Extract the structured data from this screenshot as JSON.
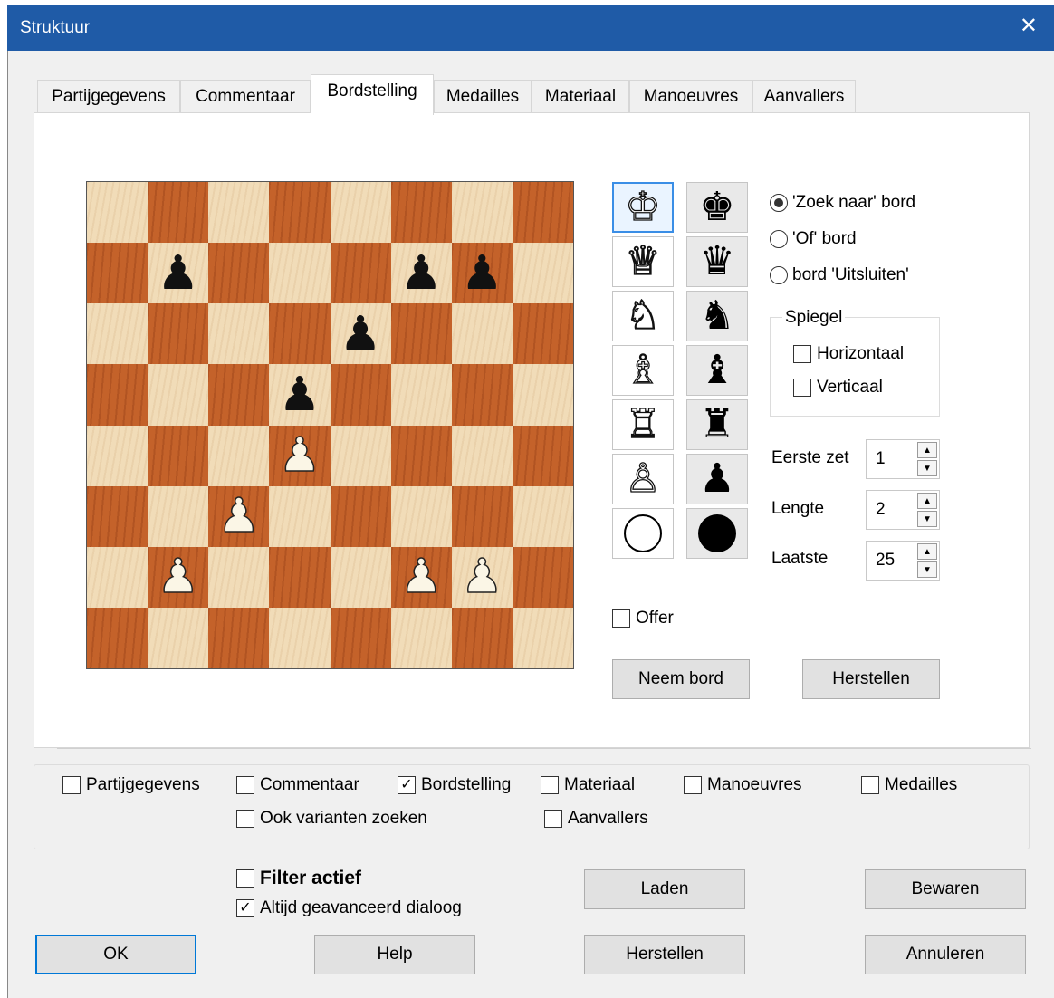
{
  "window": {
    "title": "Struktuur",
    "close_glyph": "✕"
  },
  "tabs": [
    {
      "label": "Partijgegevens",
      "active": false
    },
    {
      "label": "Commentaar",
      "active": false
    },
    {
      "label": "Bordstelling",
      "active": true
    },
    {
      "label": "Medailles",
      "active": false
    },
    {
      "label": "Materiaal",
      "active": false
    },
    {
      "label": "Manoeuvres",
      "active": false
    },
    {
      "label": "Aanvallers",
      "active": false
    }
  ],
  "board": {
    "position": [
      "........",
      ".p...pp.",
      "....p...",
      "...p....",
      "...P....",
      "..P.....",
      ".P...PP.",
      "........"
    ],
    "colors": {
      "light": "#f1dcb8",
      "dark": "#c4622a"
    }
  },
  "palette": {
    "selected": "white-king",
    "items": [
      {
        "name": "white-king-icon",
        "glyph": "♔",
        "color": "w"
      },
      {
        "name": "black-king-icon",
        "glyph": "♚",
        "color": "b"
      },
      {
        "name": "white-queen-icon",
        "glyph": "♕",
        "color": "w"
      },
      {
        "name": "black-queen-icon",
        "glyph": "♛",
        "color": "b"
      },
      {
        "name": "white-knight-icon",
        "glyph": "♘",
        "color": "w"
      },
      {
        "name": "black-knight-icon",
        "glyph": "♞",
        "color": "b"
      },
      {
        "name": "white-bishop-icon",
        "glyph": "♗",
        "color": "w"
      },
      {
        "name": "black-bishop-icon",
        "glyph": "♝",
        "color": "b"
      },
      {
        "name": "white-rook-icon",
        "glyph": "♖",
        "color": "w"
      },
      {
        "name": "black-rook-icon",
        "glyph": "♜",
        "color": "b"
      },
      {
        "name": "white-pawn-icon",
        "glyph": "♙",
        "color": "w"
      },
      {
        "name": "black-pawn-icon",
        "glyph": "♟",
        "color": "b"
      },
      {
        "name": "white-circle-icon",
        "glyph": "",
        "color": "w"
      },
      {
        "name": "black-circle-icon",
        "glyph": "",
        "color": "b"
      }
    ]
  },
  "search_mode": {
    "options": [
      {
        "label": "'Zoek naar' bord",
        "checked": true
      },
      {
        "label": "'Of' bord",
        "checked": false
      },
      {
        "label": "bord 'Uitsluiten'",
        "checked": false
      }
    ]
  },
  "mirror": {
    "group_label": "Spiegel",
    "horizontal": {
      "label": "Horizontaal",
      "checked": false
    },
    "vertical": {
      "label": "Verticaal",
      "checked": false
    }
  },
  "moves": {
    "first_move": {
      "label": "Eerste zet",
      "value": "1"
    },
    "length": {
      "label": "Lengte",
      "value": "2"
    },
    "last": {
      "label": "Laatste",
      "value": "25"
    }
  },
  "offer": {
    "label": "Offer",
    "checked": false
  },
  "board_buttons": {
    "take_board": "Neem bord",
    "reset": "Herstellen"
  },
  "options": {
    "partijgegevens": {
      "label": "Partijgegevens",
      "checked": false
    },
    "commentaar": {
      "label": "Commentaar",
      "checked": false
    },
    "bordstelling": {
      "label": "Bordstelling",
      "checked": true
    },
    "materiaal": {
      "label": "Materiaal",
      "checked": false
    },
    "manoeuvres": {
      "label": "Manoeuvres",
      "checked": false
    },
    "medailles": {
      "label": "Medailles",
      "checked": false
    },
    "varianten": {
      "label": "Ook varianten zoeken",
      "checked": false
    },
    "aanvallers": {
      "label": "Aanvallers",
      "checked": false
    }
  },
  "filter": {
    "active": {
      "label": "Filter actief",
      "checked": false
    },
    "advanced": {
      "label": "Altijd geavanceerd dialoog",
      "checked": true
    }
  },
  "buttons": {
    "load": "Laden",
    "save": "Bewaren",
    "ok": "OK",
    "help": "Help",
    "reset": "Herstellen",
    "cancel": "Annuleren"
  }
}
